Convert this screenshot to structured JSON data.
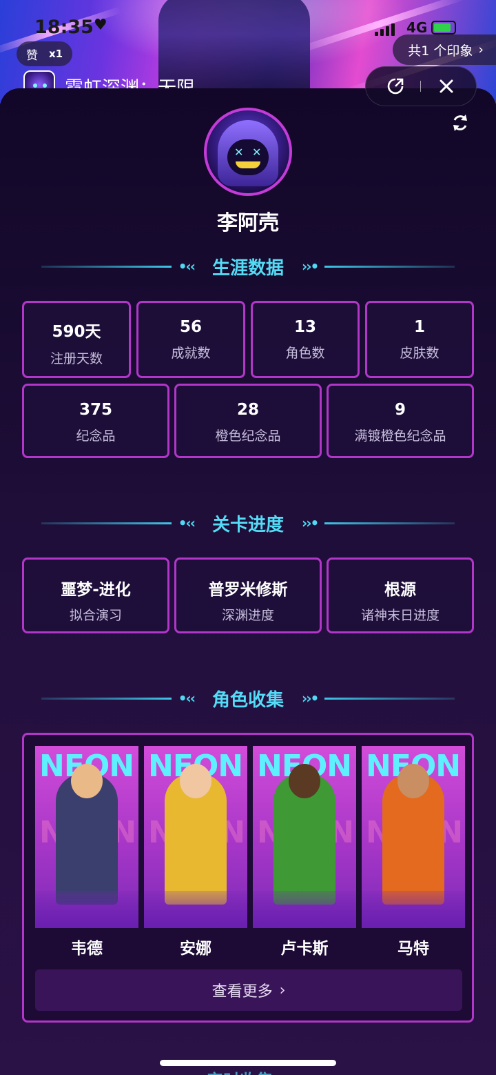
{
  "status_bar": {
    "time": "18:35",
    "network": "4G"
  },
  "banner": {
    "like_label": "赞",
    "like_count": "x1",
    "impressions": "共1 个印象",
    "app_title": "霓虹深渊：无限"
  },
  "profile": {
    "username": "李阿壳"
  },
  "sections": {
    "career": "生涯数据",
    "stages": "关卡进度",
    "characters": "角色收集",
    "next": "安时收集"
  },
  "career_stats": [
    {
      "value": "590天",
      "label": "注册天数"
    },
    {
      "value": "56",
      "label": "成就数"
    },
    {
      "value": "13",
      "label": "角色数"
    },
    {
      "value": "1",
      "label": "皮肤数"
    },
    {
      "value": "375",
      "label": "纪念品"
    },
    {
      "value": "28",
      "label": "橙色纪念品"
    },
    {
      "value": "9",
      "label": "满镀橙色纪念品"
    }
  ],
  "stage_progress": [
    {
      "value": "噩梦-进化",
      "label": "拟合演习"
    },
    {
      "value": "普罗米修斯",
      "label": "深渊进度"
    },
    {
      "value": "根源",
      "label": "诸神末日进度"
    }
  ],
  "characters": [
    {
      "name": "韦德",
      "art_text": "NEON",
      "color": "#c9372f"
    },
    {
      "name": "安娜",
      "art_text": "NEON",
      "color": "#e8b830"
    },
    {
      "name": "卢卡斯",
      "art_text": "NEON",
      "color": "#3f9a35"
    },
    {
      "name": "马特",
      "art_text": "NEON",
      "color": "#e36a1e"
    }
  ],
  "more_button": "查看更多",
  "colors": {
    "accent_cyan": "#54dcf6",
    "card_border": "#b236c8",
    "background": "#1a0d33"
  }
}
